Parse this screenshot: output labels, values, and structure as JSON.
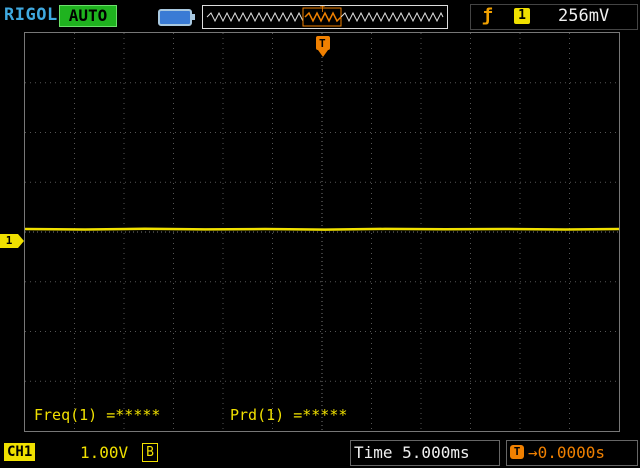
{
  "header": {
    "brand": "RIGOL",
    "mode": "AUTO",
    "trigger_edge_icon": "rising-edge-icon",
    "trigger_channel": "1",
    "trigger_level": "256mV"
  },
  "screen": {
    "channel_marker": "1",
    "trigger_marker": "T",
    "measurements": [
      {
        "label": "Freq(1) =*****"
      },
      {
        "label": "Prd(1) =*****"
      }
    ]
  },
  "footer": {
    "channel_label": "CH1",
    "volts_per_div": "1.00V",
    "bandwidth_limit": "B",
    "timebase": "Time 5.000ms",
    "offset_icon": "T",
    "trigger_offset": "→0.0000s"
  },
  "colors": {
    "ch1": "#f0e000",
    "mode": "#1fb31f",
    "brand": "#3fa9e0",
    "trigger": "#f08000"
  }
}
